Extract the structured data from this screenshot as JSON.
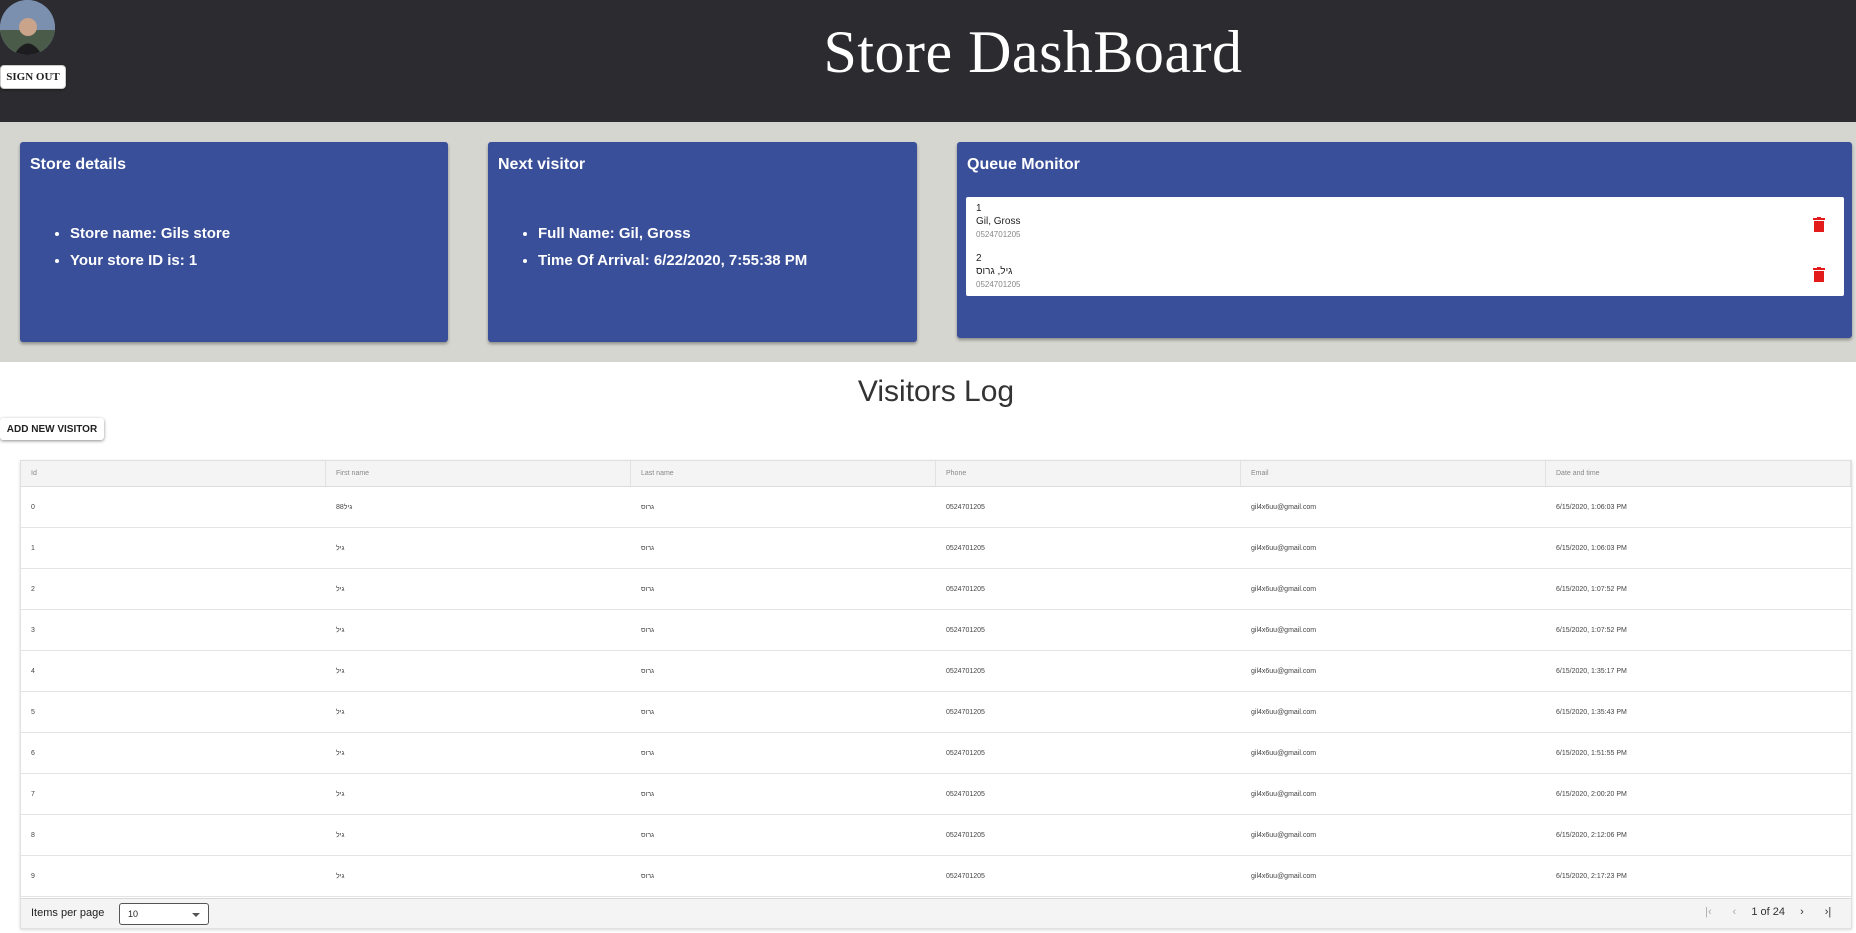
{
  "header": {
    "title": "Store DashBoard",
    "signout_label": "SIGN OUT"
  },
  "store_details": {
    "title": "Store details",
    "items": [
      "Store name: Gils store",
      "Your store ID is: 1"
    ]
  },
  "next_visitor": {
    "title": "Next visitor",
    "items": [
      "Full Name: Gil, Gross",
      "Time Of Arrival: 6/22/2020, 7:55:38 PM"
    ]
  },
  "queue_monitor": {
    "title": "Queue Monitor",
    "items": [
      {
        "num": "1",
        "name": "Gil, Gross",
        "phone": "0524701205"
      },
      {
        "num": "2",
        "name": "גיל, גרוס",
        "phone": "0524701205"
      }
    ]
  },
  "visitors_log": {
    "title": "Visitors Log",
    "add_label": "ADD NEW VISITOR",
    "columns": [
      "Id",
      "First name",
      "Last name",
      "Phone",
      "Email",
      "Date and time"
    ],
    "rows": [
      [
        "0",
        "88גיל",
        "גרוס",
        "0524701205",
        "gil4x6uu@gmail.com",
        "6/15/2020, 1:06:03 PM"
      ],
      [
        "1",
        "גיל",
        "גרוס",
        "0524701205",
        "gil4x6uu@gmail.com",
        "6/15/2020, 1:06:03 PM"
      ],
      [
        "2",
        "גיל",
        "גרוס",
        "0524701205",
        "gil4x6uu@gmail.com",
        "6/15/2020, 1:07:52 PM"
      ],
      [
        "3",
        "גיל",
        "גרוס",
        "0524701205",
        "gil4x6uu@gmail.com",
        "6/15/2020, 1:07:52 PM"
      ],
      [
        "4",
        "גיל",
        "גרוס",
        "0524701205",
        "gil4x6uu@gmail.com",
        "6/15/2020, 1:35:17 PM"
      ],
      [
        "5",
        "גיל",
        "גרוס",
        "0524701205",
        "gil4x6uu@gmail.com",
        "6/15/2020, 1:35:43 PM"
      ],
      [
        "6",
        "גיל",
        "גרוס",
        "0524701205",
        "gil4x6uu@gmail.com",
        "6/15/2020, 1:51:55 PM"
      ],
      [
        "7",
        "גיל",
        "גרוס",
        "0524701205",
        "gil4x6uu@gmail.com",
        "6/15/2020, 2:00:20 PM"
      ],
      [
        "8",
        "גיל",
        "גרוס",
        "0524701205",
        "gil4x6uu@gmail.com",
        "6/15/2020, 2:12:06 PM"
      ],
      [
        "9",
        "גיל",
        "גרוס",
        "0524701205",
        "gil4x6uu@gmail.com",
        "6/15/2020, 2:17:23 PM"
      ]
    ],
    "footer": {
      "items_per_page_label": "Items per page",
      "items_per_page_value": "10",
      "page_info": "1 of 24"
    }
  },
  "colors": {
    "header_bg": "#2c2b2f",
    "card_bg": "#3a4f99",
    "band_bg": "#d6d6d1",
    "trash": "#e31b1b"
  }
}
